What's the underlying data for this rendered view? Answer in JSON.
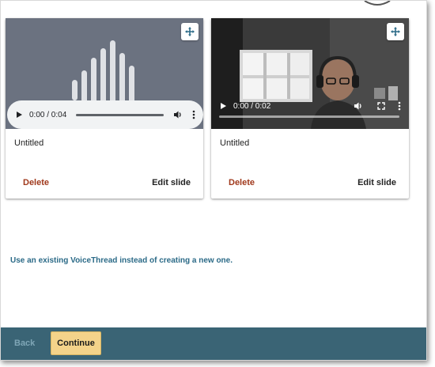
{
  "slides": [
    {
      "type": "audio",
      "time": "0:00 / 0:04",
      "title": "Untitled",
      "delete_label": "Delete",
      "edit_label": "Edit slide"
    },
    {
      "type": "video",
      "time": "0:00 / 0:02",
      "title": "Untitled",
      "delete_label": "Delete",
      "edit_label": "Edit slide"
    }
  ],
  "existing_link": "Use an existing VoiceThread instead of creating a new one.",
  "footer": {
    "back_label": "Back",
    "continue_label": "Continue"
  },
  "colors": {
    "accent_link": "#2b6a87",
    "delete": "#a0391c",
    "footer_bg": "#3a6475",
    "continue_bg": "#f4d38a"
  },
  "icons": [
    "move-icon",
    "play-icon",
    "volume-icon",
    "more-options-icon",
    "fullscreen-icon"
  ]
}
